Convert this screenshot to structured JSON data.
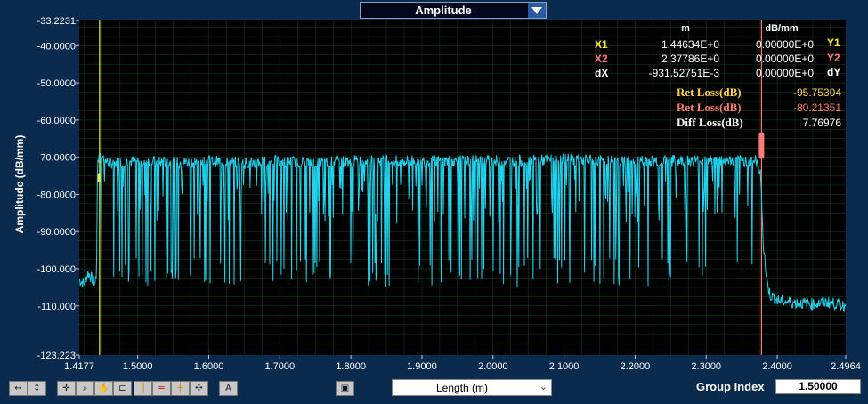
{
  "header": {
    "mode_label": "Amplitude"
  },
  "chart_data": {
    "type": "line",
    "title": "",
    "xlabel": "Length (m)",
    "ylabel": "Amplitude (dB/mm)",
    "xlim": [
      1.4177,
      2.4964
    ],
    "ylim": [
      -123.223,
      -33.2231
    ],
    "grid": true,
    "x_ticks": [
      "1.4177",
      "1.5000",
      "1.6000",
      "1.7000",
      "1.8000",
      "1.9000",
      "2.0000",
      "2.1000",
      "2.2000",
      "2.3000",
      "2.4000",
      "2.4964"
    ],
    "y_ticks": [
      "-33.2231",
      "-40.0000",
      "-50.0000",
      "-60.0000",
      "-70.0000",
      "-80.0000",
      "-90.0000",
      "-100.000",
      "-110.000",
      "-123.223"
    ],
    "series": [
      {
        "color": "#22d3ee",
        "points": [
          [
            1.4177,
            -103
          ],
          [
            1.425,
            -104
          ],
          [
            1.43,
            -101
          ],
          [
            1.44,
            -104
          ],
          [
            1.442,
            -101
          ],
          [
            1.4435,
            -71
          ],
          [
            1.446,
            -69.5
          ],
          [
            1.45,
            -70
          ],
          [
            1.455,
            -71
          ],
          [
            1.46,
            -71.5
          ],
          [
            1.5,
            -71
          ],
          [
            1.55,
            -71.5
          ],
          [
            1.6,
            -71
          ],
          [
            1.65,
            -71.5
          ],
          [
            1.7,
            -71
          ],
          [
            1.75,
            -71.5
          ],
          [
            1.8,
            -71
          ],
          [
            1.85,
            -71
          ],
          [
            1.9,
            -71
          ],
          [
            1.95,
            -71
          ],
          [
            2.0,
            -71
          ],
          [
            2.05,
            -71
          ],
          [
            2.1,
            -70.5
          ],
          [
            2.15,
            -71
          ],
          [
            2.2,
            -71
          ],
          [
            2.25,
            -71
          ],
          [
            2.3,
            -71
          ],
          [
            2.35,
            -71
          ],
          [
            2.37,
            -71
          ],
          [
            2.376,
            -74
          ],
          [
            2.378,
            -80
          ],
          [
            2.38,
            -92
          ],
          [
            2.385,
            -103
          ],
          [
            2.39,
            -107
          ],
          [
            2.4,
            -108.5
          ],
          [
            2.42,
            -109
          ],
          [
            2.45,
            -109.5
          ],
          [
            2.47,
            -109
          ],
          [
            2.4964,
            -110
          ]
        ],
        "dips_min": -105,
        "noise_floor": -104
      }
    ],
    "cursors": [
      {
        "label": "X1",
        "x": 1.44634,
        "color": "#ffee33"
      },
      {
        "label": "X2",
        "x": 2.37786,
        "color": "#ff7a7a"
      }
    ]
  },
  "readout": {
    "col_headers": {
      "m": "m",
      "db_mm": "dB/mm"
    },
    "rows": [
      {
        "label": "X1",
        "m": "1.44634E+0",
        "db": "0.00000E+0",
        "tag": "Y1"
      },
      {
        "label": "X2",
        "m": "2.37786E+0",
        "db": "0.00000E+0",
        "tag": "Y2"
      },
      {
        "label": "dX",
        "m": "-931.52751E-3",
        "db": "0.00000E+0",
        "tag": "dY"
      }
    ],
    "loss": [
      {
        "label": "Ret Loss(dB)",
        "value": "-95.75304",
        "color": "#ffd24a"
      },
      {
        "label": "Ret Loss(dB)",
        "value": "-80.21351",
        "color": "#ff7a6a"
      },
      {
        "label": "Diff Loss(dB)",
        "value": "7.76976",
        "color": "#ffffff"
      }
    ]
  },
  "controls": {
    "x_axis_select": "Length (m)",
    "group_index_label": "Group Index",
    "group_index_value": "1.50000"
  },
  "colors": {
    "background": "#0a2a4e",
    "plot_bg": "#000000",
    "grid": "#1e6b1e",
    "trace": "#22d3ee"
  }
}
